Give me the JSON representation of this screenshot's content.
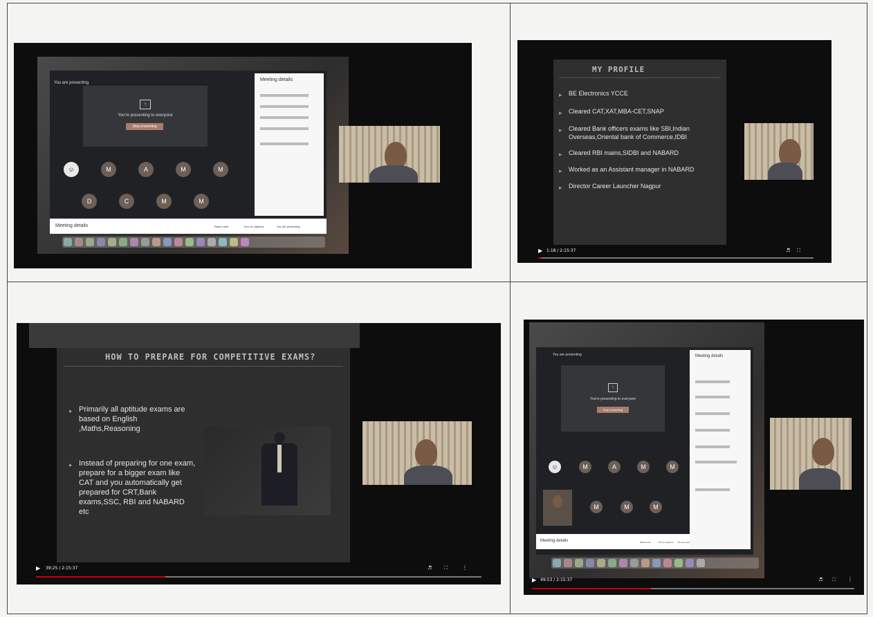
{
  "panels": {
    "top_left": {
      "presenting_label": "You are presenting",
      "presenting_to_all": "You're presenting to everyone",
      "stop_button": "Stop presenting",
      "meeting_details": "Meeting details",
      "panel_title": "Meeting details",
      "tile_letters": [
        "M",
        "A",
        "M",
        "M",
        "D",
        "C",
        "M",
        "M"
      ],
      "bottom_actions": [
        "Raise hand",
        "Turn on captions",
        "You are presenting"
      ]
    },
    "top_right": {
      "slide_title": "MY PROFILE",
      "bullets": [
        "BE Electronics YCCE",
        "Cleared CAT,XAT,MBA-CET,SNAP",
        "Cleared Bank officers exams like SBI,Indian Overseas,Oriental bank of Commerce,IDBI",
        "Cleared RBI mains,SIDBI and NABARD",
        "Worked as an Assistant manager in NABARD",
        "Director Career Launcher Nagpur"
      ],
      "time": "1:18 / 2:15:37"
    },
    "bottom_left": {
      "slide_title": "HOW TO PREPARE FOR COMPETITIVE EXAMS?",
      "bullet1": "Primarily all aptitude exams are based on English ,Maths,Reasoning",
      "bullet2": "Instead of preparing for one exam, prepare for a bigger exam like CAT and you automatically get prepared for CRT,Bank exams,SSC, RBI and NABARD etc",
      "time": "39:25 / 2:15:37"
    },
    "bottom_right": {
      "presenting_label": "You are presenting",
      "presenting_to_all": "You're presenting to everyone",
      "stop_button": "Stop presenting",
      "panel_title": "Meeting details",
      "meeting_details": "Meeting details",
      "tile_letters": [
        "M",
        "A",
        "M",
        "M",
        "M",
        "M",
        "M"
      ],
      "bottom_actions": [
        "Raise hand",
        "Turn on captions",
        "You are presenting"
      ],
      "time": "49:53 / 2:15:37"
    }
  },
  "colors": {
    "progress": "#cc0000",
    "slide_bg": "#2b2b2b",
    "page_bg": "#f4f4f2"
  }
}
